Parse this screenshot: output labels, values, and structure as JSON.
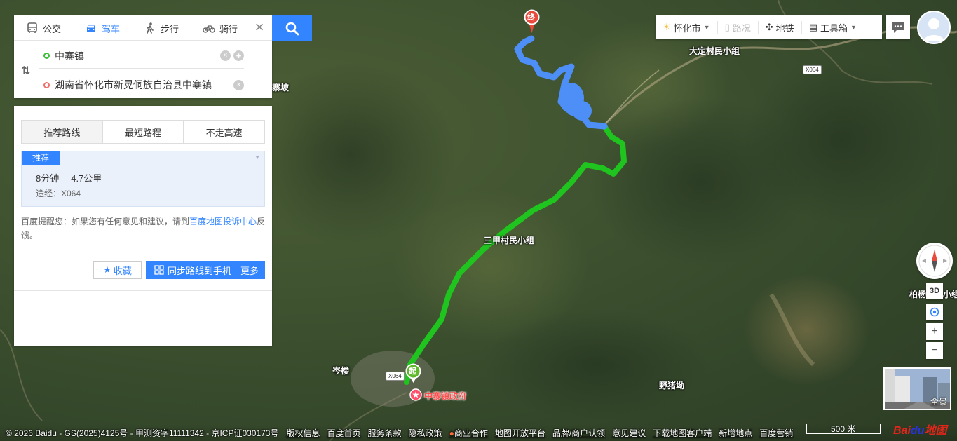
{
  "transport_tabs": [
    {
      "label": "公交",
      "icon": "bus-icon",
      "active": false
    },
    {
      "label": "驾车",
      "icon": "car-icon",
      "active": true
    },
    {
      "label": "步行",
      "icon": "walk-icon",
      "active": false
    },
    {
      "label": "骑行",
      "icon": "bike-icon",
      "active": false
    }
  ],
  "route_input": {
    "start": "中寨镇",
    "end": "湖南省怀化市新晃侗族自治县中寨镇"
  },
  "preference_tabs": [
    {
      "label": "推荐路线",
      "active": true
    },
    {
      "label": "最短路程",
      "active": false
    },
    {
      "label": "不走高速",
      "active": false
    }
  ],
  "route_result": {
    "badge": "推荐",
    "duration": "8分钟",
    "distance": "4.7公里",
    "via": "途经：X064"
  },
  "tip": {
    "prefix": "百度提醒您：如果您有任何意见和建议，请到",
    "link": "百度地图投诉中心",
    "suffix": "反馈。"
  },
  "actions": {
    "favorite": "收藏",
    "sync": "同步路线到手机",
    "more": "更多"
  },
  "toolbar": {
    "city": "怀化市",
    "traffic": "路况",
    "subway": "地铁",
    "toolbox": "工具箱"
  },
  "map_labels": {
    "top_village": "大定村民小组",
    "middle_village": "三甲村民小组",
    "left_place": "岑楼",
    "right_place": "野猪坳",
    "right_edge": "柏杨",
    "right_edge2": "小组",
    "left_top_edge": "寨坡",
    "poi": "中寨镇政府",
    "road_x064_a": "X064",
    "road_x064_b": "X064",
    "start_marker": "起",
    "end_marker": "终"
  },
  "controls": {
    "three_d": "3D",
    "plus": "+",
    "minus": "−",
    "panorama": "全景"
  },
  "footer": {
    "copyright": "© 2026 Baidu - GS(2025)4125号 - 甲测资字11111342 - 京ICP证030173号",
    "links": [
      "版权信息",
      "百度首页",
      "服务条款",
      "隐私政策",
      "商业合作",
      "地图开放平台",
      "品牌/商户认领",
      "意见建议",
      "下载地图客户端",
      "新增地点",
      "百度营销"
    ],
    "scale": "500 米",
    "logo_red": "Bai",
    "logo_blue": "du",
    "logo_suffix": "地图"
  },
  "colors": {
    "accent": "#3385ff",
    "route_green": "#1fc41f",
    "route_blue": "#4d8ef7"
  }
}
